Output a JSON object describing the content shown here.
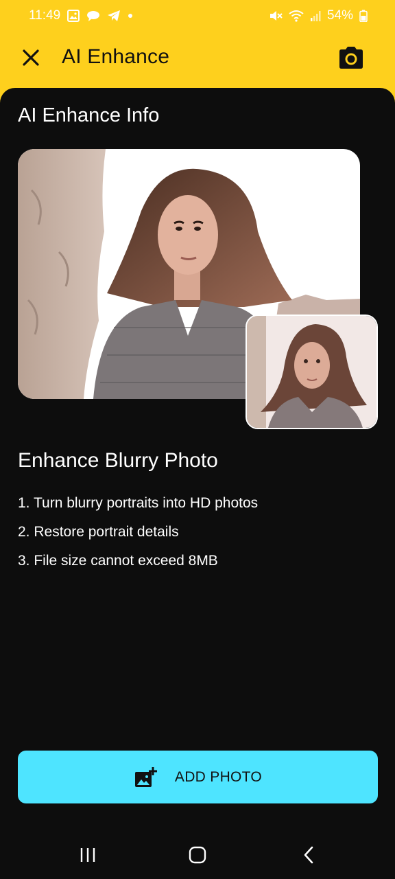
{
  "status": {
    "time": "11:49",
    "battery": "54%"
  },
  "app_bar": {
    "title": "AI Enhance"
  },
  "info": {
    "section_title": "AI Enhance Info",
    "subtitle": "Enhance Blurry Photo",
    "features": [
      "1. Turn blurry portraits into HD photos",
      "2. Restore portrait details",
      "3. File size cannot exceed 8MB"
    ]
  },
  "actions": {
    "add_photo_label": "ADD PHOTO"
  },
  "icons": {
    "close": "close-icon",
    "camera": "camera-icon",
    "add_photo": "add-photo-icon",
    "recents": "recents-icon",
    "home": "home-icon",
    "back": "back-icon"
  },
  "colors": {
    "accent_yellow": "#fed01d",
    "button_cyan": "#4ee4ff",
    "background": "#0d0d0d"
  }
}
